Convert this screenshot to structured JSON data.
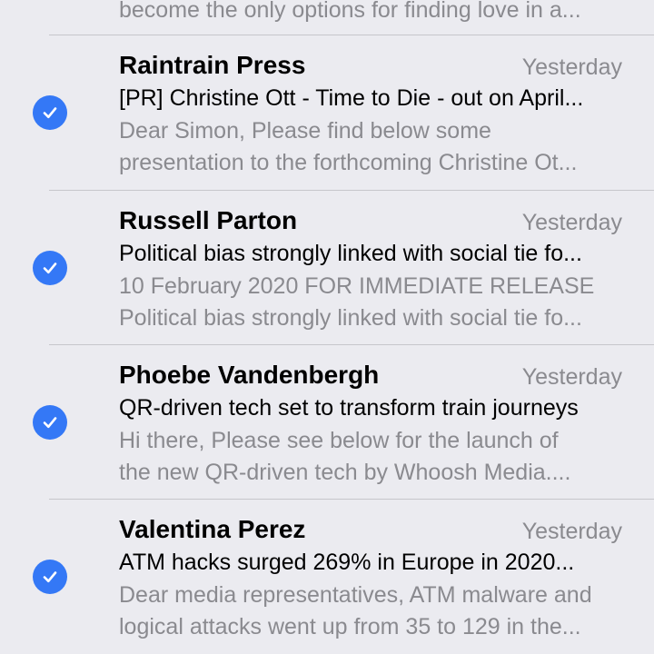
{
  "mail_list": {
    "partial_preview": "become the only options for finding love in a...",
    "messages": [
      {
        "sender": "Raintrain Press",
        "date": "Yesterday",
        "subject": "[PR] Christine Ott - Time to Die - out on April...",
        "preview_line1": "Dear Simon, Please find below some",
        "preview_line2": "presentation to the forthcoming Christine Ot...",
        "selected": true
      },
      {
        "sender": "Russell Parton",
        "date": "Yesterday",
        "subject": "Political bias strongly linked with social tie fo...",
        "preview_line1": "10 February 2020 FOR IMMEDIATE RELEASE",
        "preview_line2": "Political bias strongly linked with social tie fo...",
        "selected": true
      },
      {
        "sender": "Phoebe Vandenbergh",
        "date": "Yesterday",
        "subject": "QR-driven tech set to transform train journeys",
        "preview_line1": "Hi there, Please see below for the launch of",
        "preview_line2": "the new QR-driven tech by Whoosh Media....",
        "selected": true
      },
      {
        "sender": "Valentina Perez",
        "date": "Yesterday",
        "subject": "ATM hacks surged 269% in Europe in 2020...",
        "preview_line1": "Dear media representatives, ATM malware and",
        "preview_line2": "logical attacks went up from 35 to 129 in the...",
        "selected": true
      }
    ]
  },
  "icons": {
    "selected": "checkmark-circle-icon"
  },
  "colors": {
    "background": "#ebebf0",
    "accent": "#3478f6",
    "secondary_text": "#8a8a8f",
    "divider": "#c6c6cb"
  }
}
